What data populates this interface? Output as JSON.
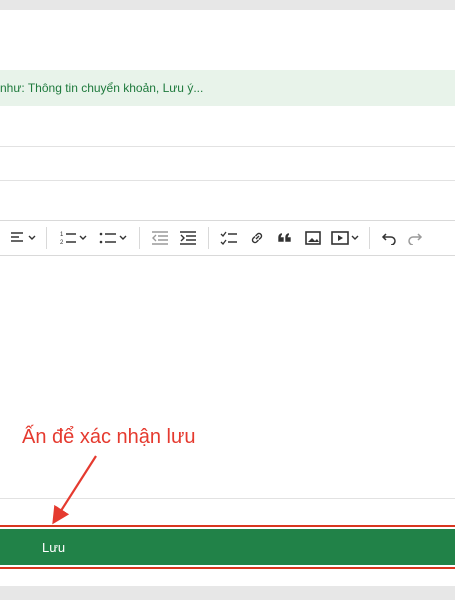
{
  "notice": {
    "text": "o như: Thông tin chuyển khoản, Lưu ý..."
  },
  "fields": [
    {
      "value": "",
      "placeholder": ""
    },
    {
      "value": "",
      "placeholder": ""
    }
  ],
  "toolbar": {
    "buttons": [
      "align-left-icon",
      "numbered-list-icon",
      "bulleted-list-icon",
      "outdent-icon",
      "indent-icon",
      "todo-list-icon",
      "link-icon",
      "blockquote-icon",
      "image-icon",
      "media-icon",
      "undo-icon",
      "redo-icon"
    ]
  },
  "editor": {
    "content": ""
  },
  "annotation": {
    "text": "Ấn để xác nhận lưu",
    "color": "#e53a2f"
  },
  "save": {
    "label": "Lưu",
    "color": "#218248"
  }
}
